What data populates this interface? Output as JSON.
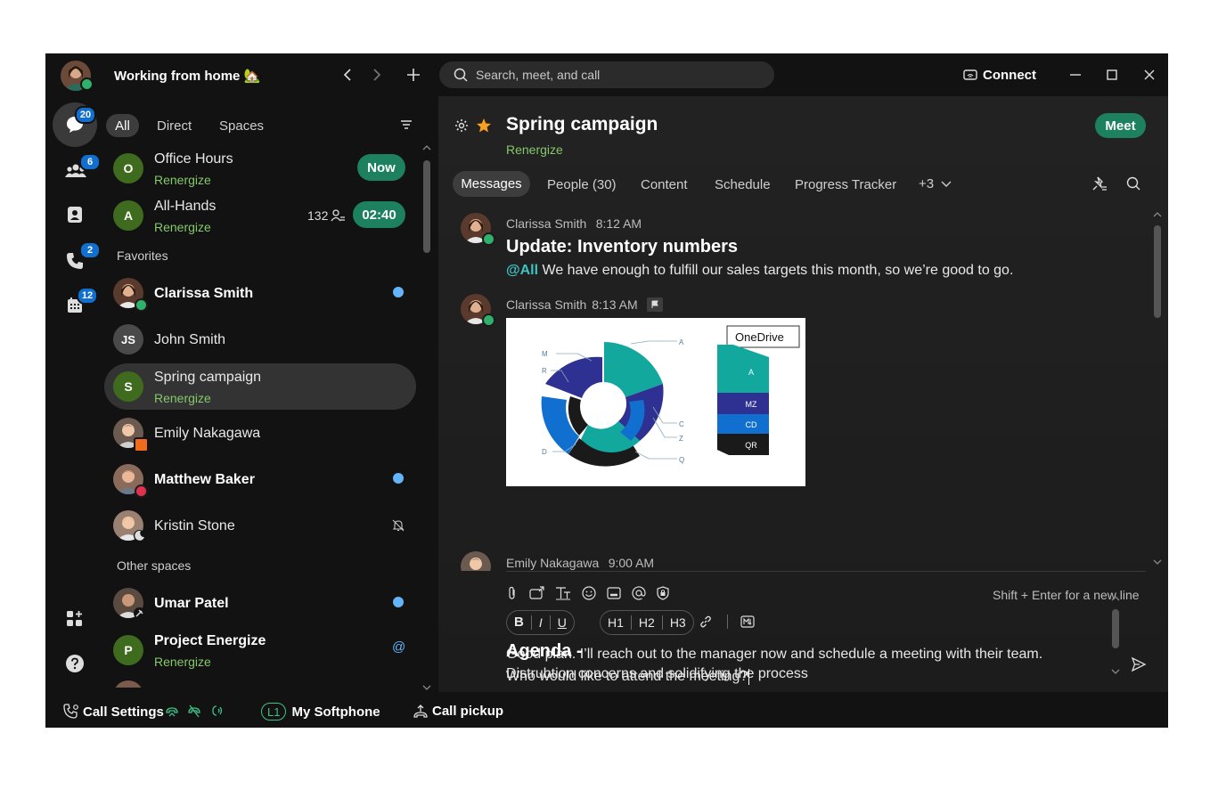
{
  "header": {
    "status_text": "Working from home 🏡",
    "search_placeholder": "Search, meet, and call",
    "connect_label": "Connect"
  },
  "rail": {
    "messages_badge": "20",
    "teams_badge": "6",
    "calls_badge": "2",
    "calendar_badge": "12"
  },
  "filters": {
    "all": "All",
    "direct": "Direct",
    "spaces": "Spaces"
  },
  "list": {
    "office_hours": {
      "initial": "O",
      "name": "Office Hours",
      "team": "Renergize",
      "action": "Now"
    },
    "all_hands": {
      "initial": "A",
      "name": "All-Hands",
      "team": "Renergize",
      "count": "132",
      "timer": "02:40"
    },
    "favorites_label": "Favorites",
    "clarissa": {
      "name": "Clarissa Smith"
    },
    "john": {
      "initials": "JS",
      "name": "John Smith"
    },
    "spring": {
      "initial": "S",
      "name": "Spring campaign",
      "team": "Renergize"
    },
    "emily": {
      "name": "Emily Nakagawa"
    },
    "matthew": {
      "name": "Matthew Baker"
    },
    "kristin": {
      "name": "Kristin Stone"
    },
    "other_spaces_label": "Other spaces",
    "umar": {
      "name": "Umar Patel"
    },
    "project": {
      "initial": "P",
      "name": "Project Energize",
      "team": "Renergize",
      "mention": "@"
    }
  },
  "space": {
    "title": "Spring campaign",
    "team": "Renergize",
    "meet_label": "Meet",
    "tabs": {
      "messages": "Messages",
      "people": "People (30)",
      "content": "Content",
      "schedule": "Schedule",
      "progress": "Progress Tracker",
      "more": "+3"
    }
  },
  "messages": [
    {
      "sender": "Clarissa Smith",
      "time": "8:12 AM",
      "heading": "Update: Inventory numbers",
      "mention": "@All",
      "text": "We have enough to fulfill our sales targets this month, so we’re good to go."
    },
    {
      "sender": "Clarissa Smith",
      "time": "8:13 AM"
    },
    {
      "sender": "Emily Nakagawa",
      "time": "9:00 AM"
    }
  ],
  "attachment": {
    "ring_labels": {
      "a": "A",
      "m": "M",
      "r": "R",
      "c": "C",
      "z": "Z",
      "q": "Q",
      "d": "D"
    },
    "onedrive": "OneDrive",
    "blocks": {
      "a": "A",
      "mz": "MZ",
      "cd": "CD",
      "qr": "QR"
    },
    "colors": {
      "teal": "#12a89d",
      "navy": "#2e3192",
      "blue": "#1170cf",
      "black": "#1a1a1a"
    }
  },
  "composer": {
    "hint": "Shift + Enter for a new line",
    "format": {
      "bold": "B",
      "italic": "I",
      "underline": "U",
      "h1": "H1",
      "h2": "H2",
      "h3": "H3"
    },
    "line1": "Good plan. I’ll reach out to the manager now and schedule a meeting with their team.",
    "line2": "Who would like to attend the meeting?",
    "heading": "Agenda -",
    "line3": "Distrubtion concerns and solidifying the process"
  },
  "footer": {
    "call_settings": "Call Settings",
    "line_badge": "L1",
    "softphone": "My Softphone",
    "call_pickup": "Call pickup"
  }
}
